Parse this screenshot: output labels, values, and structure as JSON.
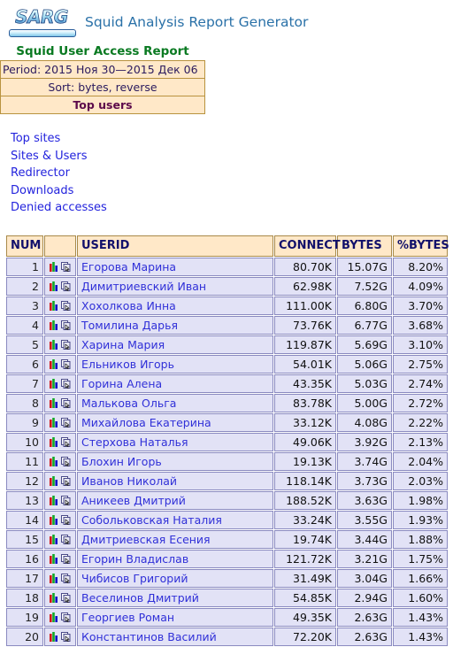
{
  "header": {
    "logo_text": "SARG",
    "logo_name": "sarg-logo",
    "app_title": "Squid Analysis Report Generator",
    "title_color": "#2a71a8"
  },
  "report": {
    "heading": "Squid User Access Report",
    "heading_color": "#0a7a22",
    "period": "Period: 2015 Ноя 30—2015 Дек 06",
    "sort": "Sort: bytes, reverse",
    "top_users": "Top users",
    "info_bg": "#ffe8c8"
  },
  "nav": {
    "items": [
      {
        "label": "Top sites"
      },
      {
        "label": "Sites & Users"
      },
      {
        "label": "Redirector"
      },
      {
        "label": "Downloads"
      },
      {
        "label": "Denied accesses"
      }
    ],
    "link_color": "#2323dd"
  },
  "table": {
    "columns": [
      {
        "key": "num",
        "label": "NUM"
      },
      {
        "key": "icons",
        "label": ""
      },
      {
        "key": "userid",
        "label": "USERID"
      },
      {
        "key": "connect",
        "label": "CONNECT"
      },
      {
        "key": "bytes",
        "label": "BYTES"
      },
      {
        "key": "pct",
        "label": "%BYTES"
      }
    ],
    "header_bg": "#ffe8c8",
    "header_color": "#11116b",
    "row_bg": "#e2e2f6",
    "row_icons": [
      "bar-chart-icon",
      "report-pages-icon"
    ],
    "rows": [
      {
        "num": "1",
        "userid": "Егорова Марина",
        "connect": "80.70K",
        "bytes": "15.07G",
        "pct": "8.20%"
      },
      {
        "num": "2",
        "userid": "Димитриевский Иван",
        "connect": "62.98K",
        "bytes": "7.52G",
        "pct": "4.09%"
      },
      {
        "num": "3",
        "userid": "Хохолкова Инна",
        "connect": "111.00K",
        "bytes": "6.80G",
        "pct": "3.70%"
      },
      {
        "num": "4",
        "userid": "Томилина Дарья",
        "connect": "73.76K",
        "bytes": "6.77G",
        "pct": "3.68%"
      },
      {
        "num": "5",
        "userid": "Харина Мария",
        "connect": "119.87K",
        "bytes": "5.69G",
        "pct": "3.10%"
      },
      {
        "num": "6",
        "userid": "Ельников Игорь",
        "connect": "54.01K",
        "bytes": "5.06G",
        "pct": "2.75%"
      },
      {
        "num": "7",
        "userid": "Горина Алена",
        "connect": "43.35K",
        "bytes": "5.03G",
        "pct": "2.74%"
      },
      {
        "num": "8",
        "userid": "Малькова Ольга",
        "connect": "83.78K",
        "bytes": "5.00G",
        "pct": "2.72%"
      },
      {
        "num": "9",
        "userid": "Михайлова Екатерина",
        "connect": "33.12K",
        "bytes": "4.08G",
        "pct": "2.22%"
      },
      {
        "num": "10",
        "userid": "Стерхова Наталья",
        "connect": "49.06K",
        "bytes": "3.92G",
        "pct": "2.13%"
      },
      {
        "num": "11",
        "userid": "Блохин Игорь",
        "connect": "19.13K",
        "bytes": "3.74G",
        "pct": "2.04%"
      },
      {
        "num": "12",
        "userid": "Иванов Николай",
        "connect": "118.14K",
        "bytes": "3.73G",
        "pct": "2.03%"
      },
      {
        "num": "13",
        "userid": "Аникеев Дмитрий",
        "connect": "188.52K",
        "bytes": "3.63G",
        "pct": "1.98%"
      },
      {
        "num": "14",
        "userid": "Собольковская Наталия",
        "connect": "33.24K",
        "bytes": "3.55G",
        "pct": "1.93%"
      },
      {
        "num": "15",
        "userid": "Дмитриевская Есения",
        "connect": "19.74K",
        "bytes": "3.44G",
        "pct": "1.88%"
      },
      {
        "num": "16",
        "userid": "Егорин Владислав",
        "connect": "121.72K",
        "bytes": "3.21G",
        "pct": "1.75%"
      },
      {
        "num": "17",
        "userid": "Чибисов Григорий",
        "connect": "31.49K",
        "bytes": "3.04G",
        "pct": "1.66%"
      },
      {
        "num": "18",
        "userid": "Веселинов Дмитрий",
        "connect": "54.85K",
        "bytes": "2.94G",
        "pct": "1.60%"
      },
      {
        "num": "19",
        "userid": "Георгиев Роман",
        "connect": "49.35K",
        "bytes": "2.63G",
        "pct": "1.43%"
      },
      {
        "num": "20",
        "userid": "Константинов Василий",
        "connect": "72.20K",
        "bytes": "2.63G",
        "pct": "1.43%"
      }
    ]
  }
}
